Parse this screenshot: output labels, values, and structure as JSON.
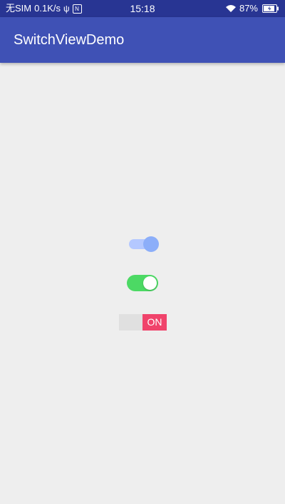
{
  "status_bar": {
    "carrier": "无SIM",
    "speed": "0.1K/s",
    "nfc": "N",
    "time": "15:18",
    "battery": "87%"
  },
  "app_bar": {
    "title": "SwitchViewDemo",
    "color": "#3f51b5"
  },
  "switches": {
    "material": {
      "state": "on",
      "track_color": "#b4c8ff",
      "thumb_color": "#8caef9"
    },
    "ios": {
      "state": "on",
      "color": "#4cd964"
    },
    "slide_box": {
      "state": "on",
      "label": "ON",
      "color": "#f0436b"
    }
  }
}
